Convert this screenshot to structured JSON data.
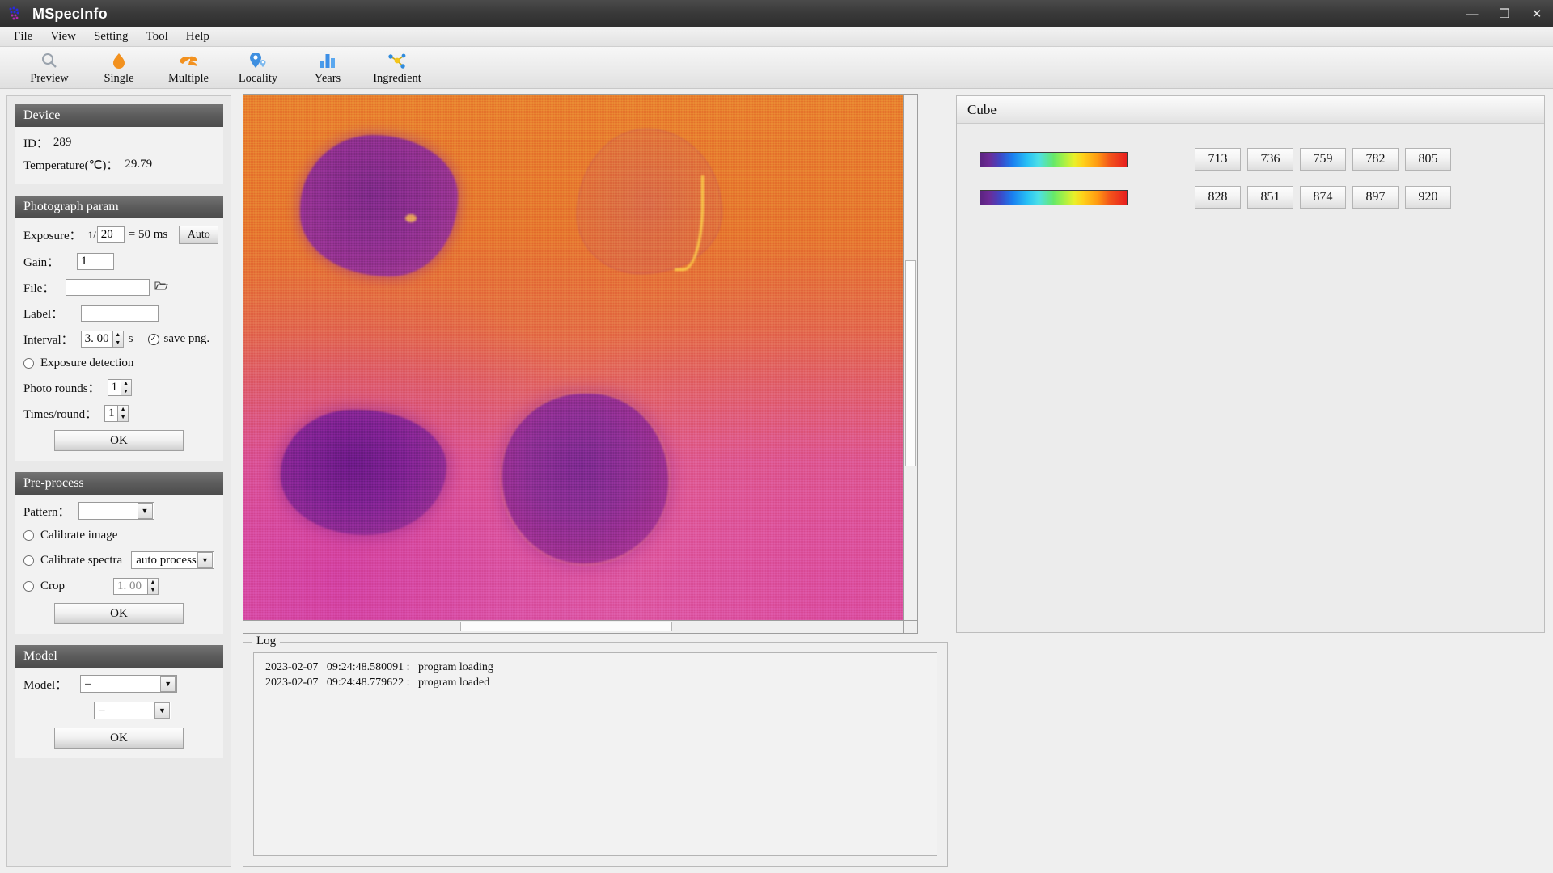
{
  "window": {
    "title": "MSpecInfo",
    "logo_icon": "molecule-logo-icon",
    "minimize_label": "—",
    "maximize_label": "❐",
    "close_label": "✕"
  },
  "menubar": {
    "items": [
      "File",
      "View",
      "Setting",
      "Tool",
      "Help"
    ]
  },
  "toolbar": {
    "items": [
      {
        "label": "Preview",
        "icon": "magnifier-icon"
      },
      {
        "label": "Single",
        "icon": "single-leaf-icon"
      },
      {
        "label": "Multiple",
        "icon": "multiple-leaf-icon"
      },
      {
        "label": "Locality",
        "icon": "map-pin-icon"
      },
      {
        "label": "Years",
        "icon": "bar-chart-icon"
      },
      {
        "label": "Ingredient",
        "icon": "molecule-icon"
      }
    ]
  },
  "device": {
    "title": "Device",
    "id_label": "ID：",
    "id_value": "289",
    "temp_label": "Temperature(℃)：",
    "temp_value": "29.79"
  },
  "photograph": {
    "title": "Photograph param",
    "exposure_label": "Exposure：",
    "exposure_prefix": "1/",
    "exposure_value": "20",
    "exposure_suffix": "= 50 ms",
    "auto_label": "Auto",
    "gain_label": "Gain：",
    "gain_value": "1",
    "file_label": "File：",
    "file_value": "",
    "folder_icon": "open-folder-icon",
    "label_label": "Label：",
    "label_value": "",
    "interval_label": "Interval：",
    "interval_value": "3. 00",
    "interval_unit": "s",
    "save_png_label": "save png.",
    "save_png_checked": true,
    "exposure_detection_label": "Exposure detection",
    "exposure_detection_checked": false,
    "photo_rounds_label": "Photo rounds：",
    "photo_rounds_value": "1",
    "times_round_label": "Times/round：",
    "times_round_value": "1",
    "ok_label": "OK"
  },
  "preprocess": {
    "title": "Pre-process",
    "pattern_label": "Pattern：",
    "pattern_value": "",
    "calibrate_image_label": "Calibrate image",
    "calibrate_image_checked": false,
    "calibrate_spectra_label": "Calibrate spectra",
    "calibrate_spectra_checked": false,
    "calibrate_spectra_mode": "auto process",
    "crop_label": "Crop",
    "crop_checked": false,
    "crop_value": "1. 00",
    "ok_label": "OK"
  },
  "model": {
    "title": "Model",
    "model_label": "Model：",
    "model_value": "–",
    "submodel_value": "–",
    "ok_label": "OK"
  },
  "preview": {
    "image_description": "hyperspectral-false-color-sample-image"
  },
  "log": {
    "title": "Log",
    "entries": [
      "2023-02-07   09:24:48.580091 :   program loading",
      "2023-02-07   09:24:48.779622 :   program loaded"
    ]
  },
  "cube": {
    "title": "Cube",
    "colorbars": [
      "spectral-colorbar-1",
      "spectral-colorbar-2"
    ],
    "wavelengths_row1": [
      "713",
      "736",
      "759",
      "782",
      "805"
    ],
    "wavelengths_row2": [
      "828",
      "851",
      "874",
      "897",
      "920"
    ]
  },
  "colors": {
    "header_dark": "#5c5c5c",
    "panel_bg": "#efefef",
    "accent_orange": "#f08a1e",
    "accent_blue": "#4a9bea"
  }
}
